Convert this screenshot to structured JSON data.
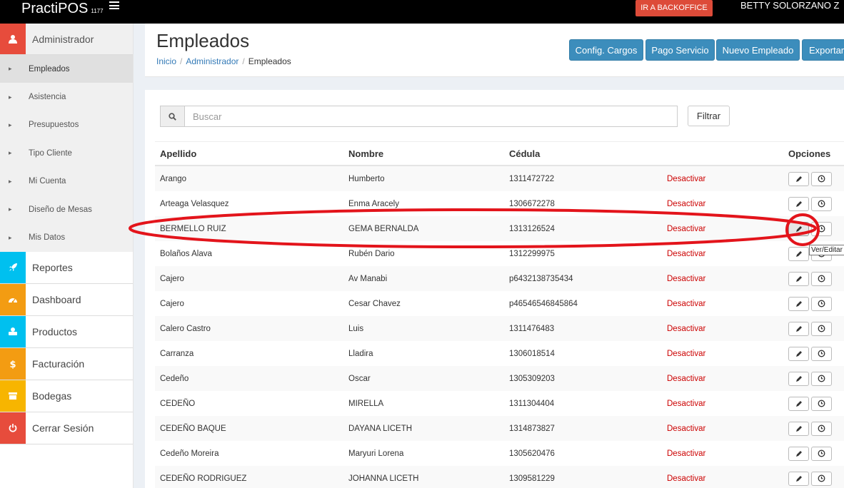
{
  "topbar": {
    "brand": "PractiPOS",
    "version": "1177",
    "backoffice_label": "IR A BACKOFFICE",
    "username": "BETTY SOLORZANO Z"
  },
  "sidebar": {
    "admin": {
      "label": "Administrador",
      "icon": "user-icon",
      "color": "#e74c3c"
    },
    "submenu": [
      "Empleados",
      "Asistencia",
      "Presupuestos",
      "Tipo Cliente",
      "Mi Cuenta",
      "Diseño de Mesas",
      "Mis Datos"
    ],
    "items": [
      {
        "label": "Reportes",
        "icon": "rocket-icon",
        "color": "#00c0ef"
      },
      {
        "label": "Dashboard",
        "icon": "dashboard-icon",
        "color": "#f39c12"
      },
      {
        "label": "Productos",
        "icon": "products-icon",
        "color": "#00c0ef"
      },
      {
        "label": "Facturación",
        "icon": "dollar-icon",
        "color": "#f39c12"
      },
      {
        "label": "Bodegas",
        "icon": "warehouse-icon",
        "color": "#f7b500"
      },
      {
        "label": "Cerrar Sesión",
        "icon": "power-icon",
        "color": "#e74c3c"
      }
    ]
  },
  "header": {
    "title": "Empleados",
    "breadcrumb": [
      "Inicio",
      "Administrador",
      "Empleados"
    ],
    "buttons": [
      "Config. Cargos",
      "Pago Servicio",
      "Nuevo Empleado",
      "Exportar"
    ]
  },
  "search": {
    "placeholder": "Buscar",
    "filter_label": "Filtrar"
  },
  "table": {
    "columns": [
      "Apellido",
      "Nombre",
      "Cédula",
      "",
      "Opciones"
    ],
    "action_label": "Desactivar",
    "rows": [
      [
        "Arango",
        "Humberto",
        "1311472722"
      ],
      [
        "Arteaga Velasquez",
        "Enma Aracely",
        "1306672278"
      ],
      [
        "BERMELLO RUIZ",
        "GEMA BERNALDA",
        "1313126524"
      ],
      [
        "Bolaños Alava",
        "Rubén Dario",
        "1312299975"
      ],
      [
        "Cajero",
        "Av Manabi",
        "p6432138735434"
      ],
      [
        "Cajero",
        "Cesar Chavez",
        "p46546546845864"
      ],
      [
        "Calero Castro",
        "Luis",
        "1311476483"
      ],
      [
        "Carranza",
        "Lladira",
        "1306018514"
      ],
      [
        "Cedeño",
        "Oscar",
        "1305309203"
      ],
      [
        "CEDEÑO",
        "MIRELLA",
        "1311304404"
      ],
      [
        "CEDEÑO BAQUE",
        "DAYANA LICETH",
        "1314873827"
      ],
      [
        "Cedeño Moreira",
        "Maryuri Lorena",
        "1305620476"
      ],
      [
        "CEDEÑO RODRIGUEZ",
        "JOHANNA LICETH",
        "1309581229"
      ]
    ]
  },
  "tooltip": "Ver/Editar",
  "annotation_color": "#e3141b"
}
